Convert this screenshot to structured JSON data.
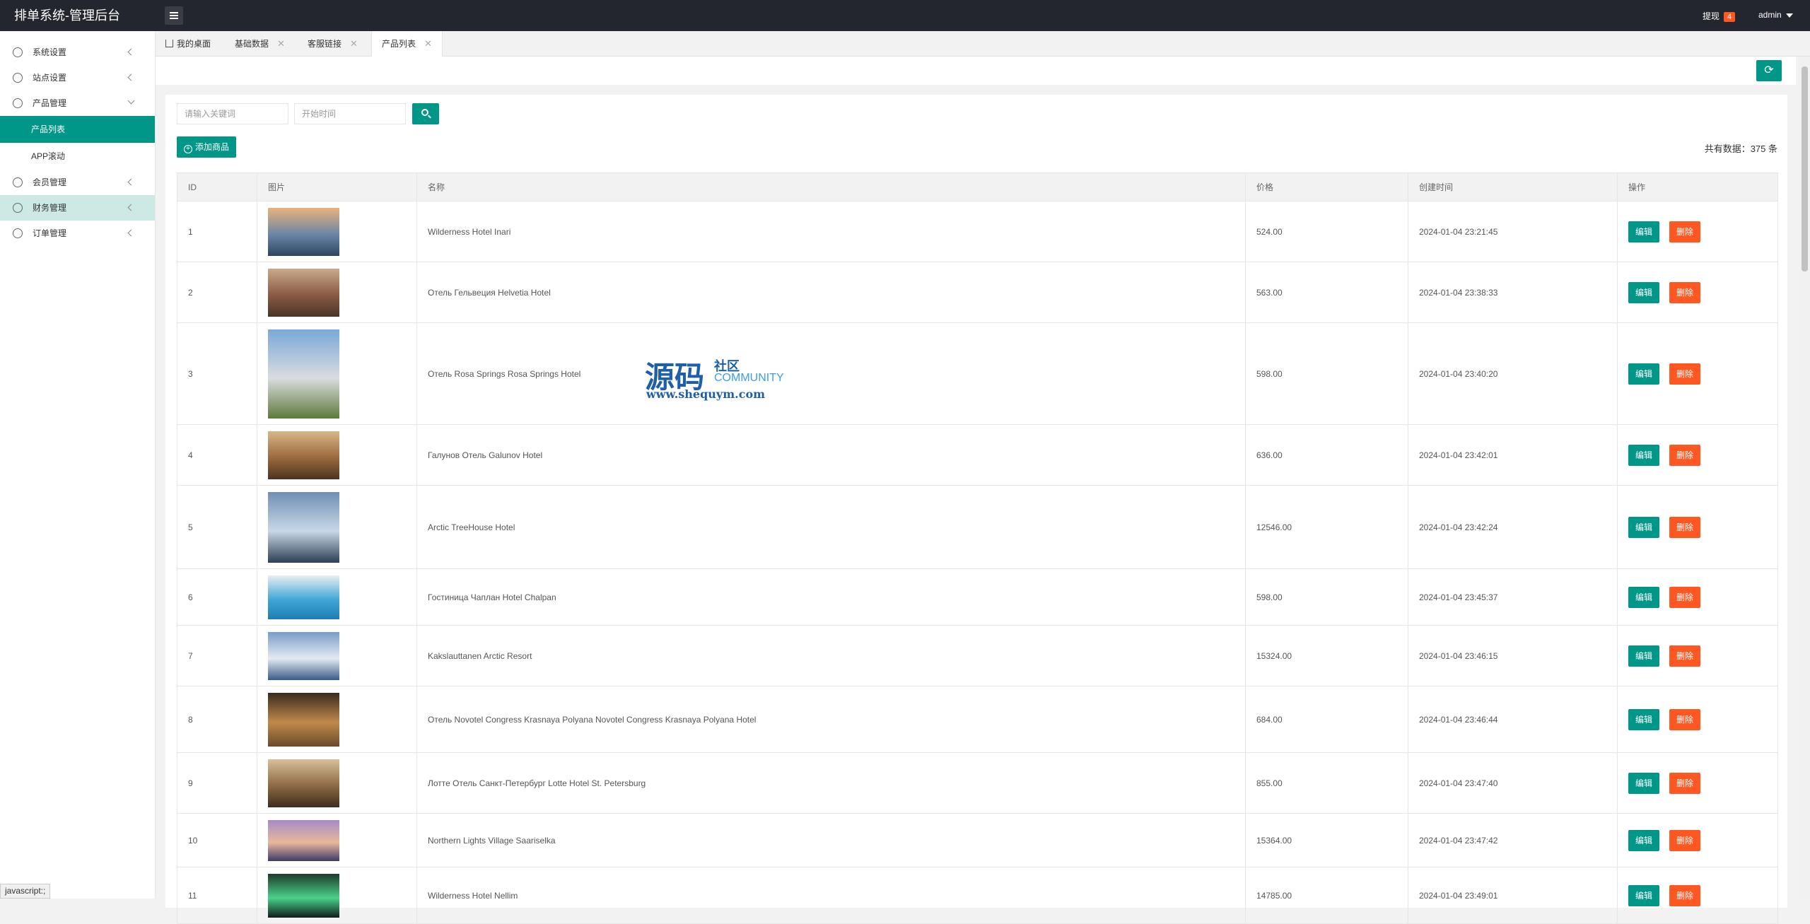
{
  "app": {
    "title": "排单系统-管理后台"
  },
  "header": {
    "withdraw_label": "提现",
    "withdraw_count": "4",
    "user": "admin"
  },
  "sidebar": {
    "items": [
      {
        "label": "系统设置",
        "icon": "gear-icon"
      },
      {
        "label": "站点设置",
        "icon": "cloud-icon"
      },
      {
        "label": "产品管理",
        "icon": "cube-icon",
        "children": [
          "产品列表",
          "APP滚动"
        ]
      },
      {
        "label": "会员管理",
        "icon": "user-icon"
      },
      {
        "label": "财务管理",
        "icon": "money-icon"
      },
      {
        "label": "订单管理",
        "icon": "order-icon"
      }
    ]
  },
  "tabs": [
    {
      "label": "我的桌面"
    },
    {
      "label": "基础数据"
    },
    {
      "label": "客服链接"
    },
    {
      "label": "产品列表"
    }
  ],
  "search": {
    "keyword_placeholder": "请输入关键词",
    "date_placeholder": "开始时间"
  },
  "toolbar": {
    "add_label": "添加商品",
    "total_text": "共有数据：375 条"
  },
  "table": {
    "columns": [
      "ID",
      "图片",
      "名称",
      "价格",
      "创建时间",
      "操作"
    ],
    "edit_label": "编辑",
    "delete_label": "删除",
    "rows": [
      {
        "id": "1",
        "name": "Wilderness Hotel Inari",
        "price": "524.00",
        "created": "2024-01-04 23:21:45",
        "thumb": [
          "#e8b37a",
          "#6b86a8",
          "#2d4560"
        ]
      },
      {
        "id": "2",
        "name": "Отель Гельвеция Helvetia Hotel",
        "price": "563.00",
        "created": "2024-01-04 23:38:33",
        "thumb": [
          "#c9a98b",
          "#8a5a45",
          "#4a3428"
        ]
      },
      {
        "id": "3",
        "name": "Отель Rosa Springs Rosa Springs Hotel",
        "price": "598.00",
        "created": "2024-01-04 23:40:20",
        "thumb": [
          "#7aa8d8",
          "#d9dcdf",
          "#5d7a3a"
        ]
      },
      {
        "id": "4",
        "name": "Галунов Отель Galunov Hotel",
        "price": "636.00",
        "created": "2024-01-04 23:42:01",
        "thumb": [
          "#d8b68a",
          "#9a6a3c",
          "#4d3320"
        ]
      },
      {
        "id": "5",
        "name": "Arctic TreeHouse Hotel",
        "price": "12546.00",
        "created": "2024-01-04 23:42:24",
        "thumb": [
          "#6f8fb5",
          "#c9d7e6",
          "#2c3e55"
        ]
      },
      {
        "id": "6",
        "name": "Гостиница Чаплан Hotel Chalpan",
        "price": "598.00",
        "created": "2024-01-04 23:45:37",
        "thumb": [
          "#e9eef2",
          "#41a6d6",
          "#1c7fb3"
        ]
      },
      {
        "id": "7",
        "name": "Kakslauttanen Arctic Resort",
        "price": "15324.00",
        "created": "2024-01-04 23:46:15",
        "thumb": [
          "#7a9cc8",
          "#e3ebf3",
          "#3a5b85"
        ]
      },
      {
        "id": "8",
        "name": "Отель Novotel Congress Krasnaya Polyana Novotel Congress Krasnaya Polyana Hotel",
        "price": "684.00",
        "created": "2024-01-04 23:46:44",
        "thumb": [
          "#3a2a1e",
          "#c08a4a",
          "#6b4a2a"
        ]
      },
      {
        "id": "9",
        "name": "Лотте Отель Санкт-Петербург Lotte Hotel St. Petersburg",
        "price": "855.00",
        "created": "2024-01-04 23:47:40",
        "thumb": [
          "#d6c09a",
          "#8c6a44",
          "#3e2c1c"
        ]
      },
      {
        "id": "10",
        "name": "Northern Lights Village Saariselka",
        "price": "15364.00",
        "created": "2024-01-04 23:47:42",
        "thumb": [
          "#a68bc8",
          "#e8b89a",
          "#3c3a6a"
        ]
      },
      {
        "id": "11",
        "name": "Wilderness Hotel Nellim",
        "price": "14785.00",
        "created": "2024-01-04 23:49:01",
        "thumb": [
          "#1f3a2a",
          "#4ad18a",
          "#0e1e18"
        ]
      }
    ]
  },
  "watermark": {
    "big": "源码",
    "small": "社区",
    "community": "COMMUNITY",
    "url": "www.shequym.com"
  },
  "statusbar": {
    "text": "javascript:;"
  }
}
